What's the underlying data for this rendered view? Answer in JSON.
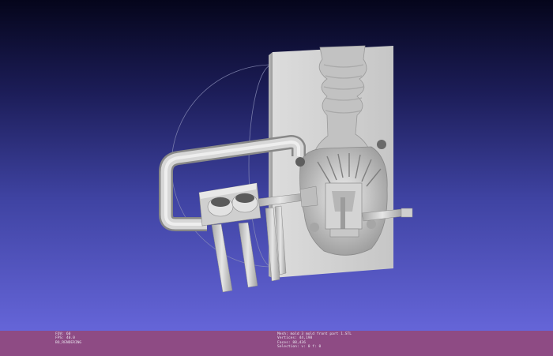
{
  "viewport": {
    "model": "mold-cross-section",
    "background_top": "#05051b",
    "background_bottom": "#6565d8"
  },
  "status_bar": {
    "background": "#8e4b84",
    "left": {
      "fov": "FOV: 60",
      "fps": "FPS:   40.0",
      "mode": "BO_RENDERING"
    },
    "right": {
      "mesh": "Mesh: mold 3 mold front part 1.STL",
      "vertices": "Vertices: 44,198",
      "faces": "Faces: 88,436",
      "selection": "Selection: v: 0 f: 0"
    }
  }
}
